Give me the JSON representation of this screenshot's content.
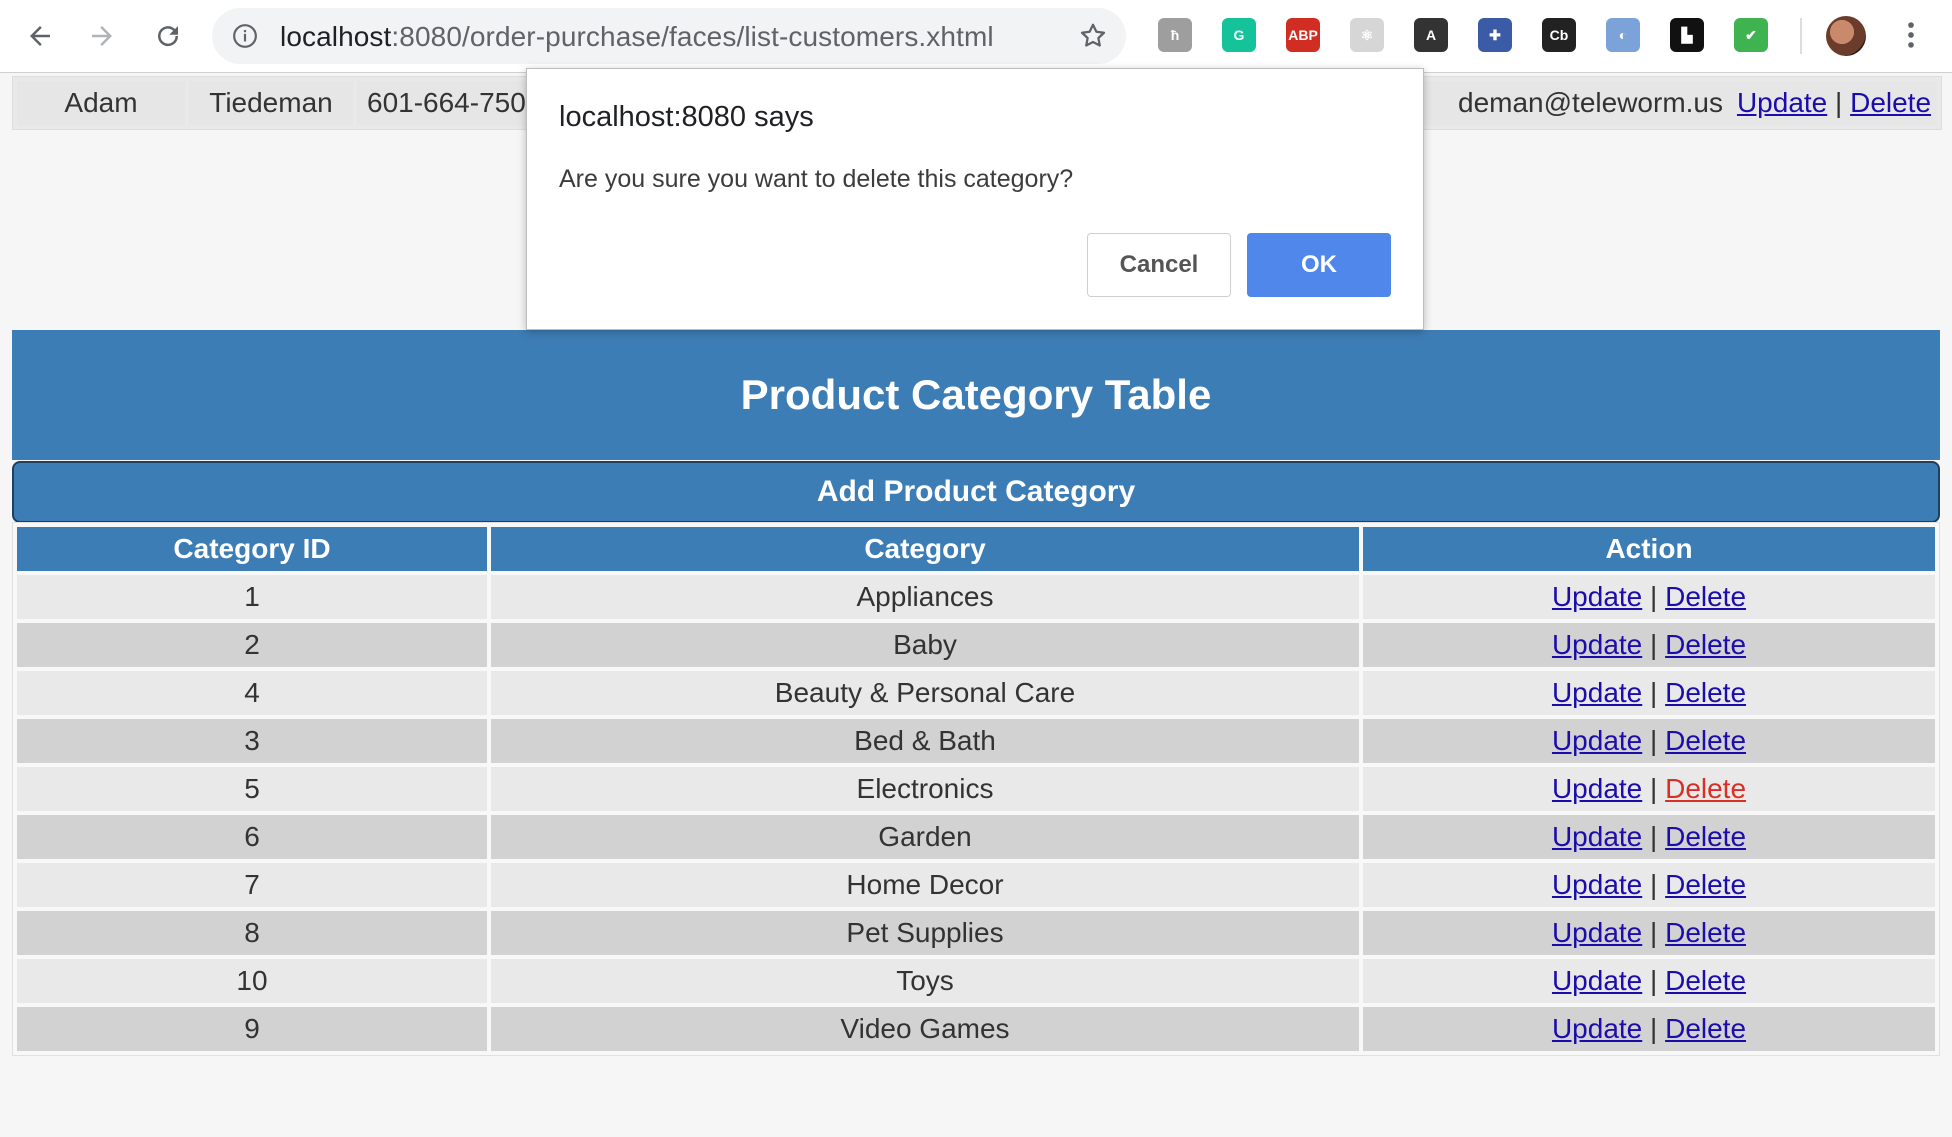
{
  "browser": {
    "url_host": "localhost",
    "url_rest": ":8080/order-purchase/faces/list-customers.xhtml",
    "extensions": [
      {
        "icon": "keep-icon",
        "label": "ħ",
        "color": "#9e9e9e"
      },
      {
        "icon": "grammarly-icon",
        "label": "G",
        "color": "#15c39a"
      },
      {
        "icon": "adblock-plus-icon",
        "label": "ABP",
        "color": "#d22d22"
      },
      {
        "icon": "react-devtools-icon",
        "label": "⚛",
        "color": "#d6d6d6"
      },
      {
        "icon": "font-extension-icon",
        "label": "A",
        "color": "#333333"
      },
      {
        "icon": "puzzle-extension-icon",
        "label": "✚",
        "color": "#3b5ba7"
      },
      {
        "icon": "cb-extension-icon",
        "label": "Cb",
        "color": "#222222"
      },
      {
        "icon": "orb-extension-icon",
        "label": "◐",
        "color": "#7ba3d9"
      },
      {
        "icon": "doc-extension-icon",
        "label": "▙",
        "color": "#111111"
      },
      {
        "icon": "shield-extension-icon",
        "label": "✔",
        "color": "#3fb34f"
      }
    ]
  },
  "customer_row": {
    "first_name": "Adam",
    "last_name": "Tiedeman",
    "phone": "601-664-750",
    "email": "deman@teleworm.us",
    "update_label": "Update",
    "separator": "|",
    "delete_label": "Delete"
  },
  "dialog": {
    "title": "localhost:8080 says",
    "message": "Are you sure you want to delete this category?",
    "cancel_label": "Cancel",
    "ok_label": "OK"
  },
  "page": {
    "title": "Product Category Table",
    "add_button_label": "Add Product Category"
  },
  "table": {
    "headers": [
      "Category ID",
      "Category",
      "Action"
    ],
    "update_label": "Update",
    "separator": "|",
    "delete_label": "Delete",
    "rows": [
      {
        "id": "1",
        "category": "Appliances"
      },
      {
        "id": "2",
        "category": "Baby"
      },
      {
        "id": "4",
        "category": "Beauty & Personal Care"
      },
      {
        "id": "3",
        "category": "Bed & Bath"
      },
      {
        "id": "5",
        "category": "Electronics"
      },
      {
        "id": "6",
        "category": "Garden"
      },
      {
        "id": "7",
        "category": "Home Decor"
      },
      {
        "id": "8",
        "category": "Pet Supplies"
      },
      {
        "id": "10",
        "category": "Toys"
      },
      {
        "id": "9",
        "category": "Video Games"
      }
    ],
    "hovered_delete_row": 4,
    "hover_color": "#d93025"
  }
}
